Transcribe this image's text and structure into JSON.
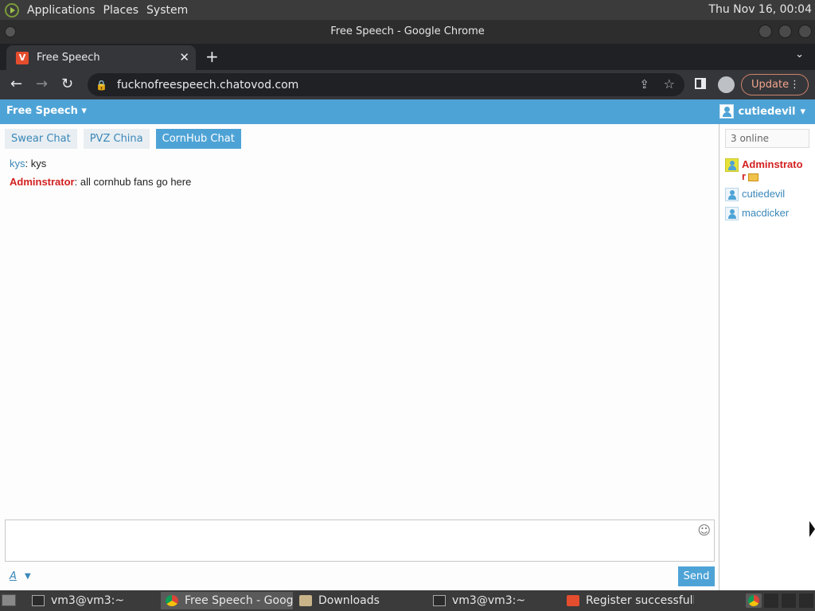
{
  "top_panel": {
    "menus": [
      "Applications",
      "Places",
      "System"
    ],
    "clock": "Thu Nov 16, 00:04"
  },
  "window": {
    "title": "Free Speech - Google Chrome"
  },
  "browser": {
    "tab_title": "Free Speech",
    "new_tab_icon": "plus-icon",
    "url": "fucknofreespeech.chatovod.com",
    "update_label": "Update"
  },
  "site": {
    "room_selector": "Free Speech",
    "username": "cutiedevil",
    "rooms": [
      {
        "label": "Swear Chat",
        "active": false
      },
      {
        "label": "PVZ China",
        "active": false
      },
      {
        "label": "CornHub Chat",
        "active": true
      }
    ],
    "messages": [
      {
        "nick": "kys",
        "text": ": kys",
        "admin": false
      },
      {
        "nick": "Adminstrator",
        "text": ": all cornhub fans go here",
        "admin": true
      }
    ],
    "online_count": "3 online",
    "users": [
      {
        "name": "Adminstrator",
        "admin": true
      },
      {
        "name": "cutiedevil",
        "admin": false
      },
      {
        "name": "macdicker",
        "admin": false
      }
    ],
    "format_label": "A",
    "send_label": "Send"
  },
  "taskbar": {
    "tasks": [
      {
        "label": "vm3@vm3:~",
        "icon": "terminal-icon"
      },
      {
        "label": "Free Speech - Goog...",
        "icon": "chrome-icon"
      },
      {
        "label": "Downloads",
        "icon": "folder-icon"
      },
      {
        "label": "vm3@vm3:~",
        "icon": "terminal-icon"
      },
      {
        "label": "Register successfull ...",
        "icon": "vivaldi-icon"
      }
    ]
  },
  "colors": {
    "accent": "#4ea3d6",
    "admin": "#d32020",
    "link": "#3a87b8"
  }
}
